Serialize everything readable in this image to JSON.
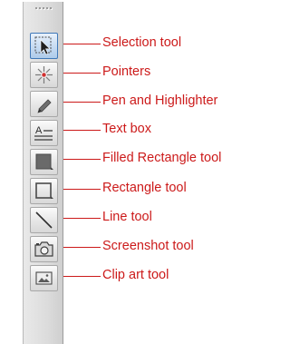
{
  "colors": {
    "label_text": "#cc1a1a",
    "connector_line": "#cc1a1a",
    "toolbar_bg": "#dcdcdc",
    "selected_button_bg": "#c6dbf2",
    "selected_button_border": "#3f78b8"
  },
  "toolbar": {
    "selected_tool": "selection",
    "tools": [
      {
        "id": "selection",
        "icon": "selection-arrow-icon",
        "label": "Selection tool"
      },
      {
        "id": "pointers",
        "icon": "pointer-burst-icon",
        "label": "Pointers"
      },
      {
        "id": "pen",
        "icon": "pen-icon",
        "label": "Pen and Highlighter"
      },
      {
        "id": "textbox",
        "icon": "text-box-icon",
        "label": "Text box"
      },
      {
        "id": "filled-rectangle",
        "icon": "filled-rectangle-icon",
        "label": "Filled Rectangle tool"
      },
      {
        "id": "rectangle",
        "icon": "rectangle-outline-icon",
        "label": "Rectangle tool"
      },
      {
        "id": "line",
        "icon": "line-icon",
        "label": "Line tool"
      },
      {
        "id": "screenshot",
        "icon": "camera-icon",
        "label": "Screenshot tool"
      },
      {
        "id": "clipart",
        "icon": "clip-art-icon",
        "label": "Clip art tool"
      }
    ]
  }
}
